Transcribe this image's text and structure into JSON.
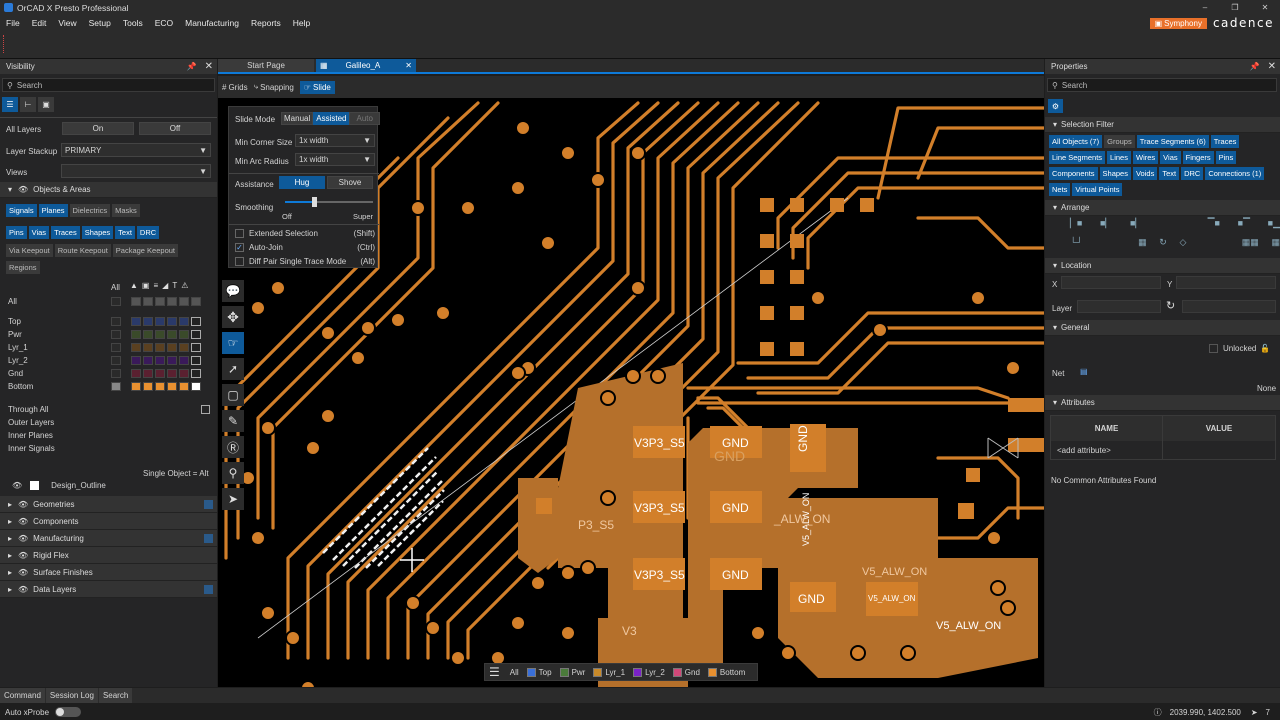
{
  "window": {
    "title": "OrCAD X Presto Professional",
    "symphony": "Symphony",
    "brand": "cadence"
  },
  "menu": [
    "File",
    "Edit",
    "View",
    "Setup",
    "Tools",
    "ECO",
    "Manufacturing",
    "Reports",
    "Help"
  ],
  "visibility": {
    "title": "Visibility",
    "search": "Search",
    "all_layers_label": "All Layers",
    "on": "On",
    "off": "Off",
    "stackup_label": "Layer Stackup",
    "stackup_value": "PRIMARY",
    "views_label": "Views",
    "objects_areas": "Objects & Areas",
    "chips1": [
      "Signals",
      "Planes",
      "Dielectrics",
      "Masks"
    ],
    "chips2": [
      "Pins",
      "Vias",
      "Traces",
      "Shapes",
      "Text",
      "DRC"
    ],
    "chips3": [
      "Via Keepout",
      "Route Keepout",
      "Package Keepout"
    ],
    "chips4": [
      "Regions"
    ],
    "all_col": "All",
    "layers": [
      "All",
      "Top",
      "Pwr",
      "Lyr_1",
      "Lyr_2",
      "Gnd",
      "Bottom"
    ],
    "extra": [
      "Through All",
      "Outer Layers",
      "Inner Planes",
      "Inner Signals"
    ],
    "single_object": "Single Object = Alt",
    "design_outline": "Design_Outline",
    "sections": [
      "Geometries",
      "Components",
      "Manufacturing",
      "Rigid Flex",
      "Surface Finishes",
      "Data Layers"
    ]
  },
  "tabs": {
    "start": "Start Page",
    "galileo": "Galileo_A"
  },
  "subtoolbar": {
    "grids": "Grids",
    "snapping": "Snapping",
    "slide": "Slide"
  },
  "slide_panel": {
    "slide_mode": "Slide Mode",
    "manual": "Manual",
    "assisted": "Assisted",
    "auto": "Auto",
    "min_corner": "Min Corner Size",
    "min_corner_val": "1x width",
    "min_arc": "Min Arc Radius",
    "min_arc_val": "1x width",
    "assistance": "Assistance",
    "hug": "Hug",
    "shove": "Shove",
    "smoothing": "Smoothing",
    "off": "Off",
    "super": "Super",
    "ext_sel": "Extended Selection",
    "ext_sel_key": "(Shift)",
    "auto_join": "Auto-Join",
    "auto_join_key": "(Ctrl)",
    "diff_pair": "Diff Pair Single Trace Mode",
    "diff_pair_key": "(Alt)"
  },
  "canvas_labels": {
    "v1": "V3P3_S5",
    "v2": "V3P3_S5",
    "v3": "V3P3_S5",
    "v4": "P3_S5",
    "g1": "GND",
    "g2": "GND",
    "g3": "GND",
    "g4": "GND",
    "g5": "GND",
    "g6": "GND",
    "a1": "V5_ALW_ON",
    "a2": "V5_ALW_ON",
    "a3": "V5_ALW_ON",
    "a4": "V5_ALW_ON",
    "a5": "_ALW_ON",
    "v5": "V3"
  },
  "layerbar": {
    "all": "All",
    "items": [
      {
        "name": "Top",
        "color": "#3a6fd8"
      },
      {
        "name": "Pwr",
        "color": "#4a7a3a"
      },
      {
        "name": "Lyr_1",
        "color": "#c88a2a"
      },
      {
        "name": "Lyr_2",
        "color": "#7a22c8"
      },
      {
        "name": "Gnd",
        "color": "#d04878"
      },
      {
        "name": "Bottom",
        "color": "#e89030"
      }
    ]
  },
  "properties": {
    "title": "Properties",
    "search": "Search",
    "selection_filter": "Selection Filter",
    "chips": [
      "All Objects (7)",
      "Groups",
      "Trace Segments (6)",
      "Traces",
      "Line Segments",
      "Lines",
      "Wires",
      "Vias",
      "Fingers",
      "Pins",
      "Components",
      "Shapes",
      "Voids",
      "Text",
      "DRC",
      "Connections (1)",
      "Nets",
      "Virtual Points"
    ],
    "arrange": "Arrange",
    "location": "Location",
    "x": "X",
    "y": "Y",
    "layer": "Layer",
    "general": "General",
    "unlocked": "Unlocked",
    "net": "Net",
    "none": "None",
    "attributes": "Attributes",
    "name_col": "NAME",
    "value_col": "VALUE",
    "add_attr": "<add attribute>",
    "no_common": "No Common Attributes Found"
  },
  "bottom_tabs": [
    "Command",
    "Session Log",
    "Search"
  ],
  "status": {
    "auto_xprobe": "Auto xProbe",
    "coords": "2039.990, 1402.500",
    "count": "7"
  },
  "colors": {
    "copper": "#d27f2a",
    "shape": "#b5702b",
    "accent": "#0e5a9a",
    "panel": "#252526"
  }
}
